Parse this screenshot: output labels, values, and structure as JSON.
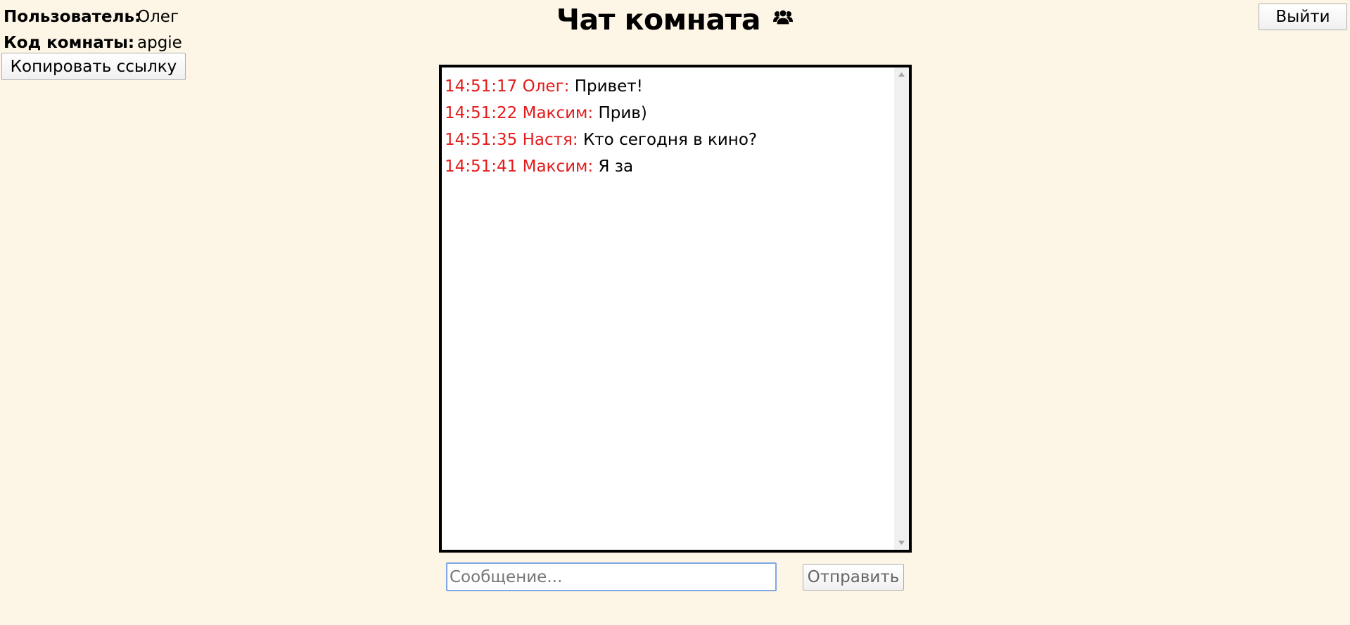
{
  "info": {
    "user_label": "Пользователь:",
    "user_value": "Олег",
    "room_label": "Код комнаты:",
    "room_value": "apgie"
  },
  "buttons": {
    "copy_link": "Копировать ссылку",
    "exit": "Выйти",
    "send": "Отправить"
  },
  "title": {
    "text": "Чат комната",
    "icon": "users-icon"
  },
  "messages": [
    {
      "meta": "14:51:17 Олег:",
      "text": "Привет!"
    },
    {
      "meta": "14:51:22 Максим:",
      "text": "Прив)"
    },
    {
      "meta": "14:51:35 Настя:",
      "text": "Кто сегодня в кино?"
    },
    {
      "meta": "14:51:41 Максим:",
      "text": "Я за"
    }
  ],
  "input": {
    "placeholder": "Сообщение...",
    "value": ""
  },
  "colors": {
    "background": "#fdf5e6",
    "message_meta": "#e41b1b",
    "input_focus_border": "#7fa7e6"
  }
}
